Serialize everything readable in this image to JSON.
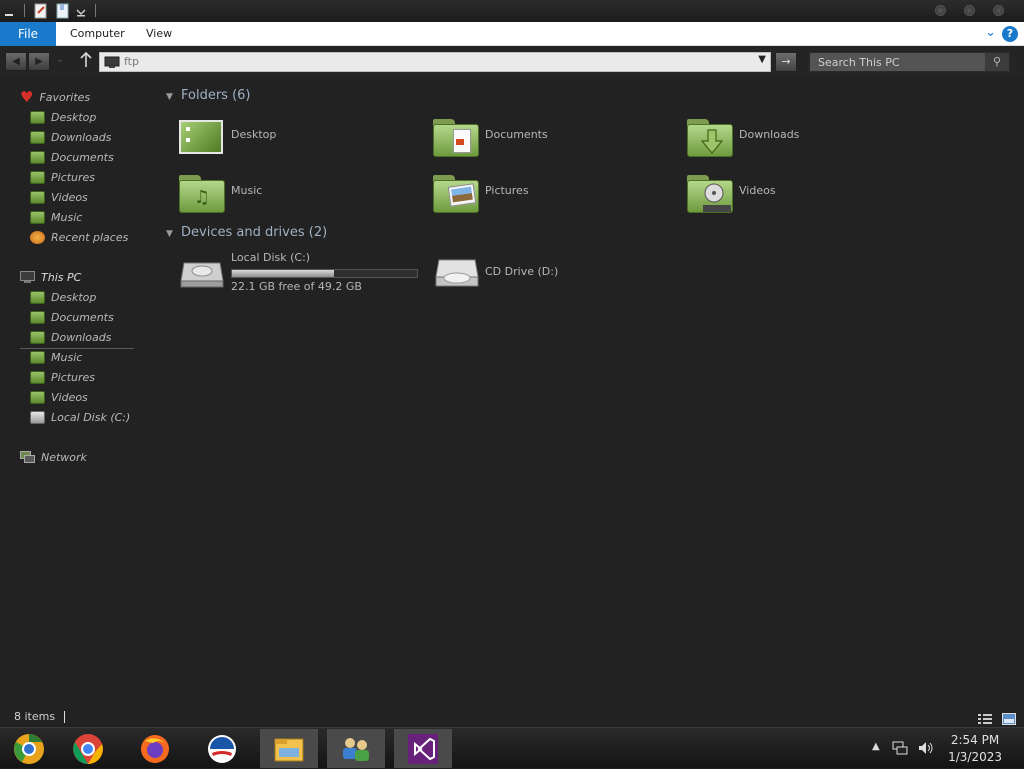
{
  "ribbon": {
    "tabs": [
      "File",
      "Computer",
      "View"
    ],
    "help": "?"
  },
  "address": {
    "path": "ftp",
    "search_placeholder": "Search This PC"
  },
  "sidebar": {
    "favorites_header": "Favorites",
    "favorites": [
      "Desktop",
      "Downloads",
      "Documents",
      "Pictures",
      "Videos",
      "Music",
      "Recent places"
    ],
    "this_pc_header": "This PC",
    "this_pc": [
      "Desktop",
      "Documents",
      "Downloads",
      "Music",
      "Pictures",
      "Videos",
      "Local Disk (C:)"
    ],
    "network": "Network"
  },
  "main": {
    "folders_header": "Folders (6)",
    "folders": [
      "Desktop",
      "Documents",
      "Downloads",
      "Music",
      "Pictures",
      "Videos"
    ],
    "devices_header": "Devices and drives (2)",
    "drives": [
      {
        "name": "Local Disk (C:)",
        "free_text": "22.1 GB free of 49.2 GB",
        "used_fraction": 0.55
      },
      {
        "name": "CD Drive (D:)"
      }
    ]
  },
  "status": {
    "items": "8 items"
  },
  "taskbar": {
    "apps": [
      "chrome-canary",
      "chrome",
      "firefox",
      "obama-logo",
      "file-explorer",
      "people-network",
      "visual-studio"
    ],
    "time": "2:54 PM",
    "date": "1/3/2023"
  },
  "colors": {
    "accent": "#1979ca",
    "folder_green": "#8bb35a",
    "background": "#222222"
  }
}
